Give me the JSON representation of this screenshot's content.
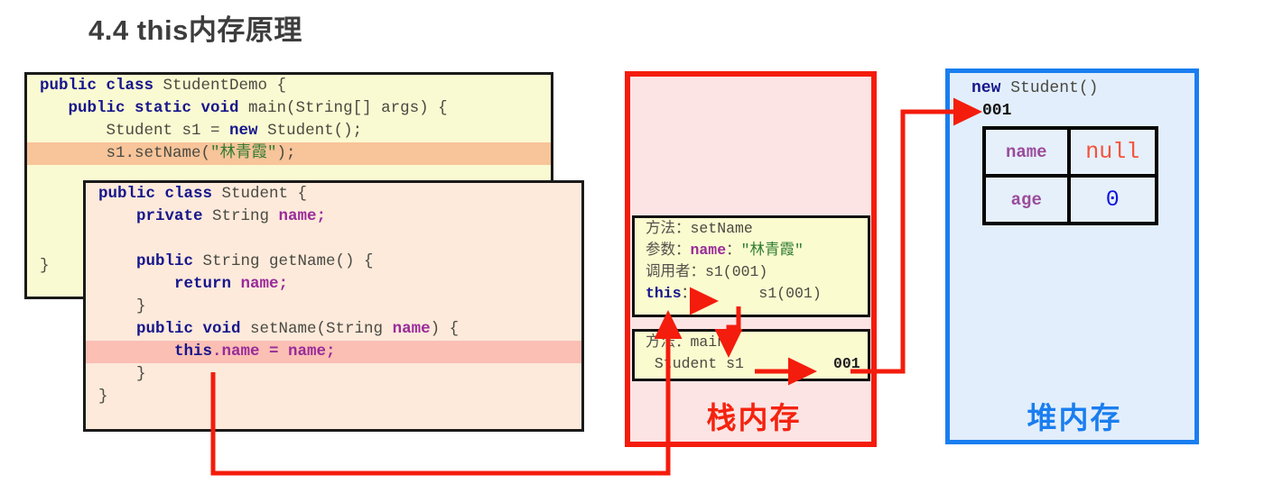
{
  "title": "4.4 this内存原理",
  "code_blocks": [
    {
      "name": "StudentDemo",
      "lines": [
        {
          "segments": [
            {
              "t": "public class ",
              "c": "kw"
            },
            {
              "t": "StudentDemo {",
              "c": "pl"
            }
          ],
          "highlight": "none"
        },
        {
          "segments": [
            {
              "t": "   public static void ",
              "c": "kw"
            },
            {
              "t": "main(String[] args) {",
              "c": "pl"
            }
          ],
          "highlight": "none"
        },
        {
          "segments": [
            {
              "t": "       Student s1 = ",
              "c": "pl"
            },
            {
              "t": "new ",
              "c": "kw"
            },
            {
              "t": "Student();",
              "c": "pl"
            }
          ],
          "highlight": "none"
        },
        {
          "segments": [
            {
              "t": "       s1.setName(",
              "c": "pl"
            },
            {
              "t": "\"林青霞\"",
              "c": "str"
            },
            {
              "t": ");",
              "c": "pl"
            }
          ],
          "highlight": "orange"
        },
        {
          "segments": [
            {
              "t": "",
              "c": "pl"
            }
          ],
          "highlight": "none"
        },
        {
          "segments": [
            {
              "t": "",
              "c": "pl"
            }
          ],
          "highlight": "none"
        },
        {
          "segments": [
            {
              "t": "",
              "c": "pl"
            }
          ],
          "highlight": "none"
        },
        {
          "segments": [
            {
              "t": "",
              "c": "pl"
            }
          ],
          "highlight": "none"
        },
        {
          "segments": [
            {
              "t": "}",
              "c": "pl"
            }
          ],
          "highlight": "none"
        }
      ]
    },
    {
      "name": "Student",
      "lines": [
        {
          "segments": [
            {
              "t": "public class ",
              "c": "kw"
            },
            {
              "t": "Student {",
              "c": "pl"
            }
          ],
          "highlight": "none"
        },
        {
          "segments": [
            {
              "t": "    private ",
              "c": "kw"
            },
            {
              "t": "String ",
              "c": "pl"
            },
            {
              "t": "name;",
              "c": "fld"
            }
          ],
          "highlight": "none"
        },
        {
          "segments": [
            {
              "t": "",
              "c": "pl"
            }
          ],
          "highlight": "none"
        },
        {
          "segments": [
            {
              "t": "    public ",
              "c": "kw"
            },
            {
              "t": "String getName() {",
              "c": "pl"
            }
          ],
          "highlight": "none"
        },
        {
          "segments": [
            {
              "t": "        return ",
              "c": "kw"
            },
            {
              "t": "name;",
              "c": "fld"
            }
          ],
          "highlight": "none"
        },
        {
          "segments": [
            {
              "t": "    }",
              "c": "pl"
            }
          ],
          "highlight": "none"
        },
        {
          "segments": [
            {
              "t": "    public void ",
              "c": "kw"
            },
            {
              "t": "setName(String ",
              "c": "pl"
            },
            {
              "t": "name",
              "c": "fld"
            },
            {
              "t": ") {",
              "c": "pl"
            }
          ],
          "highlight": "none"
        },
        {
          "segments": [
            {
              "t": "        ",
              "c": "pl"
            },
            {
              "t": "this",
              "c": "kw"
            },
            {
              "t": ".name = name;",
              "c": "fld"
            }
          ],
          "highlight": "pink"
        },
        {
          "segments": [
            {
              "t": "    }",
              "c": "pl"
            }
          ],
          "highlight": "none"
        },
        {
          "segments": [
            {
              "t": "}",
              "c": "pl"
            }
          ],
          "highlight": "none"
        }
      ]
    }
  ],
  "stack": {
    "label": "栈内存",
    "label_color": "#f4230f",
    "border_color": "#f41c0c",
    "background": "#fce4e4",
    "frames": [
      {
        "name": "setName-frame",
        "lines": [
          {
            "segments": [
              {
                "t": "方法：",
                "c": "cn"
              },
              {
                "t": "setName",
                "c": "pl"
              }
            ]
          },
          {
            "segments": [
              {
                "t": "参数：",
                "c": "cn"
              },
              {
                "t": "name",
                "c": "fld"
              },
              {
                "t": "：",
                "c": "cn"
              },
              {
                "t": "\"林青霞\"",
                "c": "str"
              }
            ]
          },
          {
            "segments": [
              {
                "t": "调用者：",
                "c": "cn"
              },
              {
                "t": "s1(001)",
                "c": "pl"
              }
            ]
          },
          {
            "segments": [
              {
                "t": "this",
                "c": "this-kw"
              },
              {
                "t": "：       s1(001)",
                "c": "pl"
              }
            ]
          }
        ]
      },
      {
        "name": "main-frame",
        "lines": [
          {
            "segments": [
              {
                "t": "方法：",
                "c": "cn"
              },
              {
                "t": "main",
                "c": "pl"
              }
            ]
          },
          {
            "segments": [
              {
                "t": " Student s1          ",
                "c": "pl"
              },
              {
                "t": "001",
                "c": "mono-b"
              }
            ]
          }
        ]
      }
    ]
  },
  "heap": {
    "label": "堆内存",
    "label_color": "#1a7ef0",
    "border_color": "#1a7ef0",
    "background": "#e2eefb",
    "object_title_kw": "new ",
    "object_title_rest": "Student()",
    "address": "001",
    "fields": [
      {
        "key": "name",
        "value": "null",
        "value_style": "val-null"
      },
      {
        "key": "age",
        "value": "0",
        "value_style": "val-zero"
      }
    ]
  },
  "arrow_color": "#f41c0c"
}
